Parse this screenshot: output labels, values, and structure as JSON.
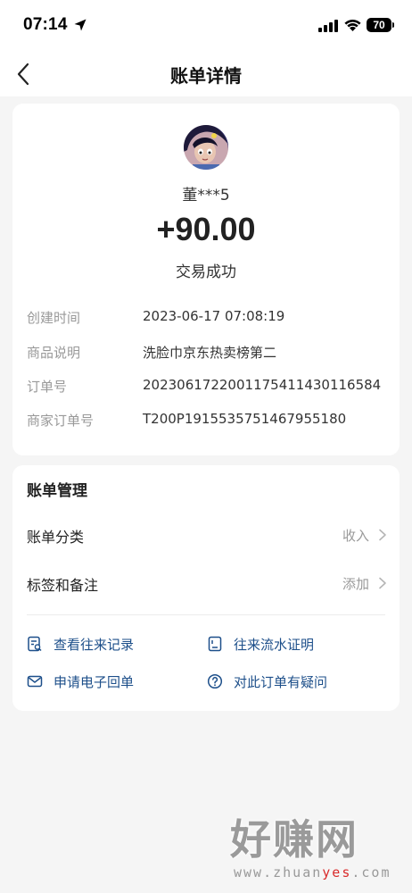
{
  "status_bar": {
    "time": "07:14",
    "battery": "70"
  },
  "nav": {
    "title": "账单详情"
  },
  "transaction": {
    "counterparty": "董***5",
    "amount": "+90.00",
    "status": "交易成功"
  },
  "details": [
    {
      "label": "创建时间",
      "value": "2023-06-17 07:08:19"
    },
    {
      "label": "商品说明",
      "value": "洗脸巾京东热卖榜第二"
    },
    {
      "label": "订单号",
      "value": "20230617220011754114301165​84"
    },
    {
      "label": "商家订单号",
      "value": "T200P1915535751467955180"
    }
  ],
  "management": {
    "title": "账单管理",
    "rows": [
      {
        "label": "账单分类",
        "value": "收入"
      },
      {
        "label": "标签和备注",
        "value": "添加"
      }
    ],
    "actions": [
      {
        "label": "查看往来记录",
        "icon": "record-icon"
      },
      {
        "label": "往来流水证明",
        "icon": "statement-icon"
      },
      {
        "label": "申请电子回单",
        "icon": "mail-icon"
      },
      {
        "label": "对此订单有疑问",
        "icon": "question-icon"
      }
    ]
  },
  "watermark": {
    "brand": "好赚网",
    "url_prefix": "www.zhuan",
    "url_accent": "yes",
    "url_suffix": ".com"
  },
  "colors": {
    "link": "#1d4f8a",
    "background": "#f5f5f5",
    "muted": "#999999"
  }
}
